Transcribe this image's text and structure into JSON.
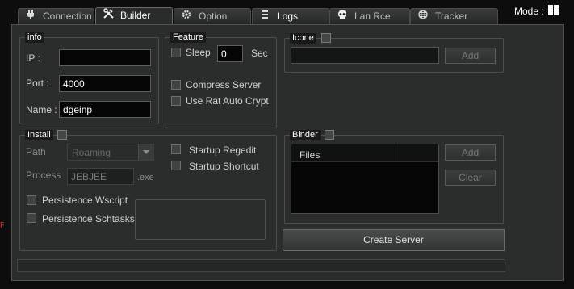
{
  "tabs": [
    {
      "label": "Connection",
      "icon": "plug-icon"
    },
    {
      "label": "Builder",
      "icon": "tools-icon"
    },
    {
      "label": "Option",
      "icon": "gear-icon"
    },
    {
      "label": "Logs",
      "icon": "list-icon"
    },
    {
      "label": "Lan Rce",
      "icon": "skull-icon"
    },
    {
      "label": "Tracker",
      "icon": "globe-icon"
    }
  ],
  "mode": {
    "label": "Mode :",
    "icon": "windows-icon"
  },
  "info": {
    "legend": "info",
    "ip_label": "IP :",
    "ip_value": "",
    "port_label": "Port :",
    "port_value": "4000",
    "name_label": "Name :",
    "name_value": "dgeinp"
  },
  "feature": {
    "legend": "Feature",
    "sleep_label": "Sleep",
    "sleep_value": "0",
    "sleep_unit": "Sec",
    "compress_label": "Compress Server",
    "autocrypt_label": "Use Rat Auto Crypt"
  },
  "icone": {
    "legend": "Icone",
    "path_value": "",
    "add_label": "Add"
  },
  "install": {
    "legend": "Install",
    "path_label": "Path",
    "path_value": "Roaming",
    "process_label": "Process",
    "process_value": "JEBJEE",
    "process_ext": ".exe",
    "startup_regedit_label": "Startup Regedit",
    "startup_shortcut_label": "Startup Shortcut",
    "persist_wscript_label": "Persistence Wscript",
    "persist_schtasks_label": "Persistence Schtasks"
  },
  "binder": {
    "legend": "Binder",
    "column_files": "Files",
    "add_label": "Add",
    "clear_label": "Clear"
  },
  "create_label": "Create Server",
  "progress": 0,
  "colors": {
    "background": "#2b2d2d",
    "field": "#050505",
    "accent": "#ffffff"
  }
}
